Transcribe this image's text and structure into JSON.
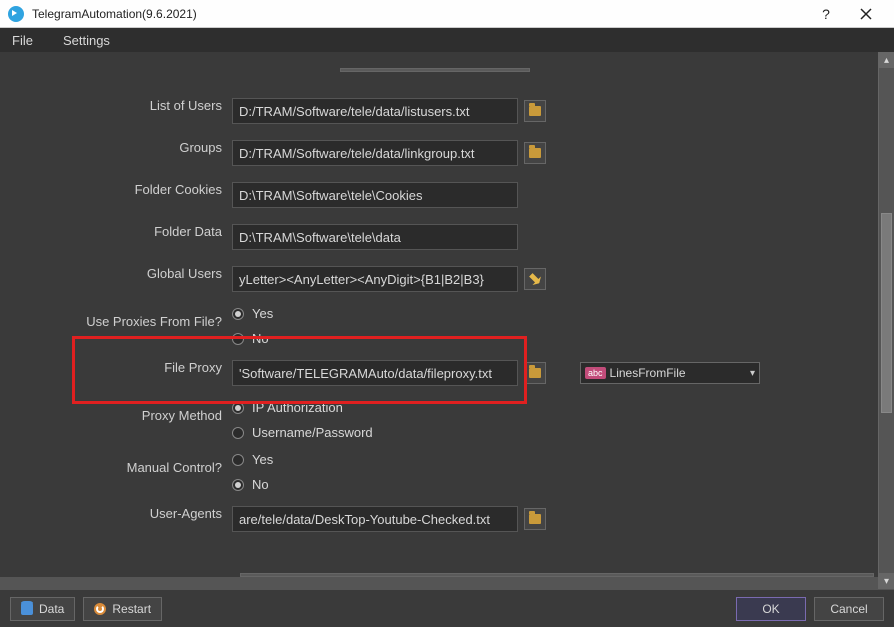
{
  "window": {
    "title": "TelegramAutomation(9.6.2021)"
  },
  "menu": {
    "file": "File",
    "settings": "Settings"
  },
  "form": {
    "list_of_users": {
      "label": "List of Users",
      "value": "D:/TRAM/Software/tele/data/listusers.txt"
    },
    "groups": {
      "label": "Groups",
      "value": "D:/TRAM/Software/tele/data/linkgroup.txt"
    },
    "folder_cookies": {
      "label": "Folder Cookies",
      "value": "D:\\TRAM\\Software\\tele\\Cookies"
    },
    "folder_data": {
      "label": "Folder Data",
      "value": "D:\\TRAM\\Software\\tele\\data"
    },
    "global_users": {
      "label": "Global Users",
      "value": "yLetter><AnyLetter><AnyDigit>{B1|B2|B3}"
    },
    "use_proxies": {
      "label": "Use Proxies From File?",
      "yes": "Yes",
      "no": "No"
    },
    "file_proxy": {
      "label": "File Proxy",
      "value": "'Software/TELEGRAMAuto/data/fileproxy.txt"
    },
    "file_proxy_select": {
      "badge": "abc",
      "text": "LinesFromFile"
    },
    "proxy_method": {
      "label": "Proxy Method",
      "ip": "IP Authorization",
      "userpass": "Username/Password"
    },
    "manual_control": {
      "label": "Manual Control?",
      "yes": "Yes",
      "no": "No"
    },
    "user_agents": {
      "label": "User-Agents",
      "value": "are/tele/data/DeskTop-Youtube-Checked.txt"
    }
  },
  "footer": {
    "data": "Data",
    "restart": "Restart",
    "ok": "OK",
    "cancel": "Cancel"
  }
}
